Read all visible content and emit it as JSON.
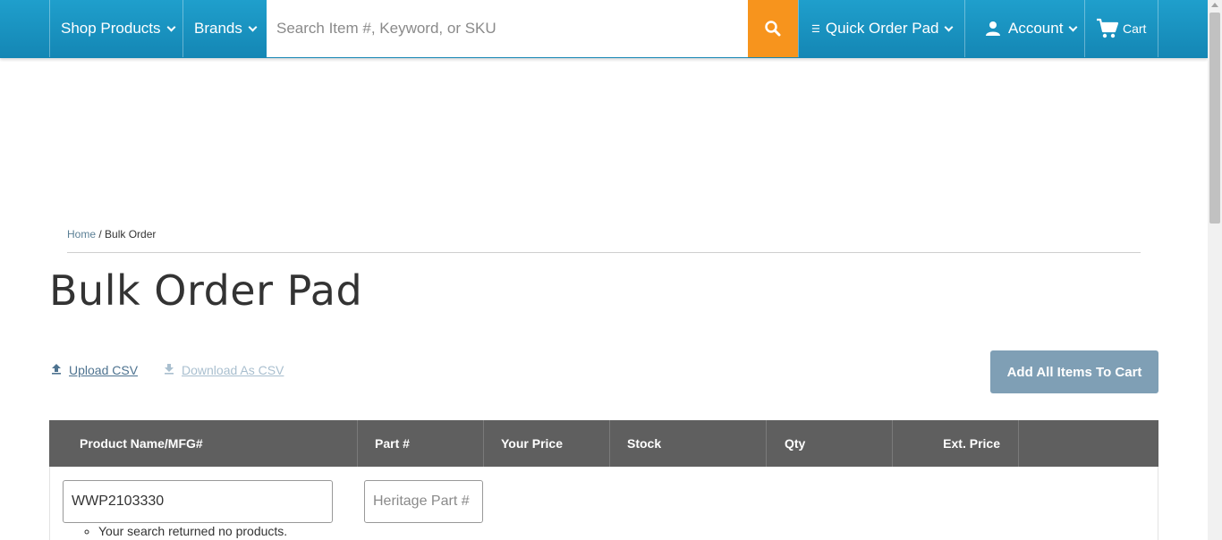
{
  "nav": {
    "shop_products": "Shop Products",
    "brands": "Brands",
    "search_placeholder": "Search Item #, Keyword, or SKU",
    "quick_order_pad": "Quick Order Pad",
    "account": "Account",
    "cart": "Cart"
  },
  "breadcrumb": {
    "home": "Home",
    "separator": " / ",
    "current": "Bulk Order"
  },
  "page_title": "Bulk Order Pad",
  "actions": {
    "upload_csv": "Upload CSV",
    "download_csv": "Download As CSV",
    "add_all": "Add All Items To Cart"
  },
  "table": {
    "headers": [
      "Product Name/MFG#",
      "Part #",
      "Your Price",
      "Stock",
      "Qty",
      "Ext. Price"
    ],
    "row": {
      "product_value": "WWP2103330",
      "part_placeholder": "Heritage Part #",
      "error": "Your search returned no products."
    }
  },
  "colors": {
    "nav": "#1b95c4",
    "search_button": "#f7941d",
    "add_all_button": "#7f9fb5",
    "table_header": "#5f5f5f"
  }
}
